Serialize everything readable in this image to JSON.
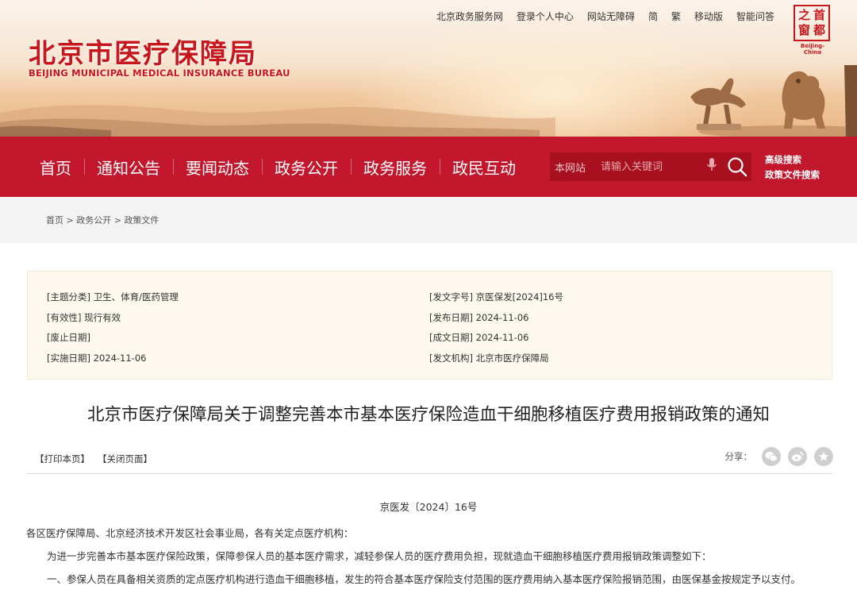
{
  "header": {
    "logo_cn": "北京市医疗保障局",
    "logo_en": "BEIJING MUNICIPAL MEDICAL INSURANCE BUREAU",
    "top_links": [
      "北京政务服务网",
      "登录个人中心",
      "网站无障碍",
      "简",
      "繁",
      "移动版",
      "智能问答"
    ],
    "seal": {
      "chars": [
        "之",
        "首",
        "窗",
        "都"
      ],
      "caption": "Beijing-China"
    }
  },
  "nav": {
    "items": [
      "首页",
      "通知公告",
      "要闻动态",
      "政务公开",
      "政务服务",
      "政民互动"
    ],
    "search_scope": "本网站",
    "search_placeholder": "请输入关键词",
    "advanced_search": "高级搜索",
    "policy_search": "政策文件搜索"
  },
  "breadcrumb": [
    "首页",
    "政务公开",
    "政策文件"
  ],
  "metadata": {
    "left": [
      "[主题分类] 卫生、体育/医药管理",
      "[有效性] 现行有效",
      "[废止日期]",
      "[实施日期] 2024-11-06"
    ],
    "right": [
      "[发文字号] 京医保发[2024]16号",
      "[发布日期] 2024-11-06",
      "[成文日期] 2024-11-06",
      "[发文机构] 北京市医疗保障局"
    ]
  },
  "article": {
    "title": "北京市医疗保障局关于调整完善本市基本医疗保险造血干细胞移植医疗费用报销政策的通知",
    "print_label": "【打印本页】",
    "close_label": "【关闭页面】",
    "share_label": "分享：",
    "share_icons": [
      "wechat-icon",
      "weibo-icon",
      "favorite-icon"
    ],
    "doc_number": "京医发〔2024〕16号",
    "salutation": "各区医疗保障局、北京经济技术开发区社会事业局，各有关定点医疗机构：",
    "paragraphs": [
      "为进一步完善本市基本医疗保险政策，保障参保人员的基本医疗需求，减轻参保人员的医疗费用负担，现就造血干细胞移植医疗费用报销政策调整如下：",
      "一、参保人员在具备相关资质的定点医疗机构进行造血干细胞移植，发生的符合基本医疗保险支付范围的医疗费用纳入基本医疗保险报销范围，由医保基金按规定予以支付。"
    ]
  },
  "colors": {
    "brand_red": "#c2172d",
    "logo_red": "#c8161d",
    "meta_bg": "#fdf9ef"
  }
}
